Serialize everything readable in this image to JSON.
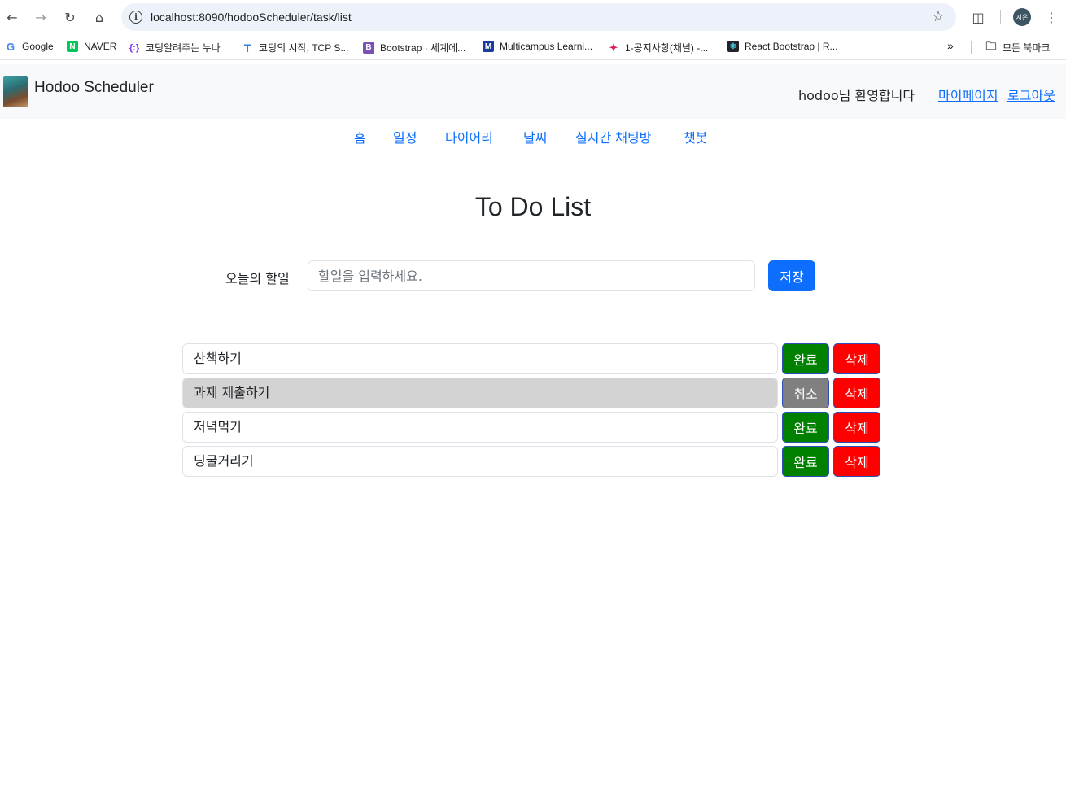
{
  "browser": {
    "url": "localhost:8090/hodooScheduler/task/list",
    "profile_initials": "지은",
    "bookmarks": [
      {
        "label": "Google",
        "icon": "google-icon",
        "color": "#4285f4"
      },
      {
        "label": "NAVER",
        "icon": "naver-icon",
        "color": "#03c75a"
      },
      {
        "label": "코딩알려주는 누나",
        "icon": "code-bracket-icon",
        "color": "#7b2ff7"
      },
      {
        "label": "코딩의 시작, TCP S...",
        "icon": "t-letter-icon",
        "color": "#3a7bd5"
      },
      {
        "label": "Bootstrap · 세계에...",
        "icon": "bootstrap-icon",
        "color": "#7952b3"
      },
      {
        "label": "Multicampus Learni...",
        "icon": "multicampus-icon",
        "color": "#1a3d9c"
      },
      {
        "label": "1-공지사항(채널) -...",
        "icon": "slack-icon",
        "color": "#e01e5a"
      },
      {
        "label": "React Bootstrap | R...",
        "icon": "react-bootstrap-icon",
        "color": "#41e0fd"
      }
    ],
    "all_bookmarks_label": "모든 북마크"
  },
  "header": {
    "brand": "Hodoo Scheduler",
    "welcome": "hodoo님 환영합니다",
    "mypage_label": "마이페이지",
    "logout_label": "로그아웃"
  },
  "nav": {
    "items": [
      {
        "label": "홈"
      },
      {
        "label": "일정"
      },
      {
        "label": "다이어리"
      },
      {
        "label": "날씨"
      },
      {
        "label": "실시간 채팅방"
      },
      {
        "label": "챗봇"
      }
    ]
  },
  "main": {
    "title": "To Do List",
    "input_label": "오늘의 할일",
    "input_placeholder": "할일을 입력하세요.",
    "save_label": "저장",
    "tasks": [
      {
        "text": "산책하기",
        "done": false,
        "action_label": "완료",
        "delete_label": "삭제"
      },
      {
        "text": "과제 제출하기",
        "done": true,
        "action_label": "취소",
        "delete_label": "삭제"
      },
      {
        "text": "저녁먹기",
        "done": false,
        "action_label": "완료",
        "delete_label": "삭제"
      },
      {
        "text": "딩굴거리기",
        "done": false,
        "action_label": "완료",
        "delete_label": "삭제"
      }
    ]
  },
  "colors": {
    "primary": "#0d6efd",
    "done_button": "#008000",
    "cancel_button": "#808080",
    "delete_button": "#ff0000",
    "done_row": "#d3d3d3"
  }
}
